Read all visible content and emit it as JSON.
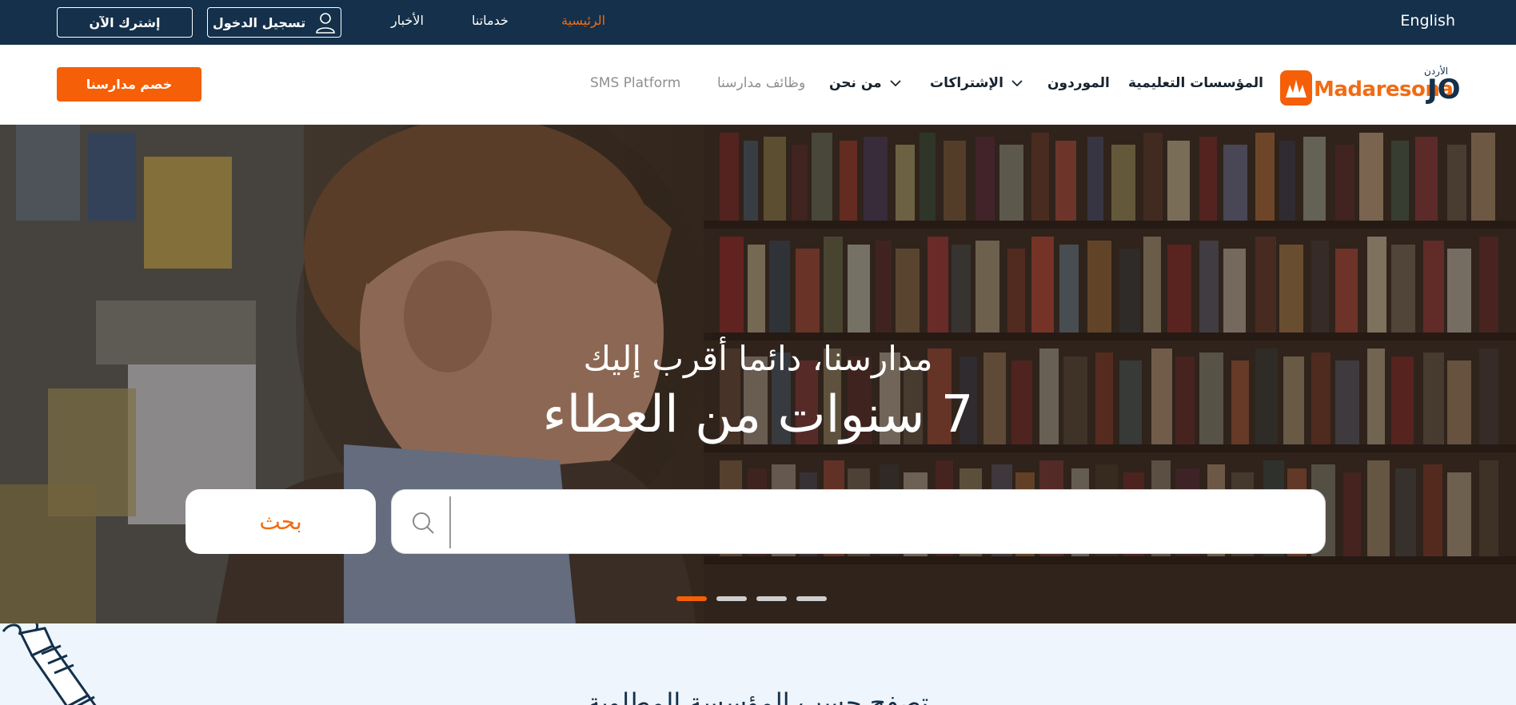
{
  "topbar": {
    "subscribe_label": "إشترك الآن",
    "login_label": "تسجيل الدخول",
    "links": [
      "الأخبار",
      "خدماتنا",
      "الرئيسية"
    ],
    "language_label": "English"
  },
  "navbar": {
    "cta_label": "خصم مدارسنا",
    "items": [
      "SMS Platform",
      "وظائف مدارسنا",
      "من نحن",
      "الإشتراكات",
      "الموردون",
      "المؤسسات التعليمية"
    ],
    "logo": {
      "name": "Madaresona",
      "suffix": "JO",
      "country": "الأردن"
    }
  },
  "hero": {
    "line1": "مدارسنا، دائما أقرب إليك",
    "line2": "7 سنوات من العطاء",
    "search_button_label": "بحث",
    "search_value": "",
    "slides_total": 4,
    "active_slide": 1
  },
  "section": {
    "title": "تصفح حسب المؤسسة المطلوبة"
  },
  "colors": {
    "navy": "#14304a",
    "accent": "#f55f08",
    "accent_text": "#f26b13",
    "section_bg": "#eef5fc"
  },
  "icons": [
    "user-icon",
    "chevron-down-icon",
    "search-icon",
    "logo-mark-icon",
    "paintbrush-icon"
  ]
}
